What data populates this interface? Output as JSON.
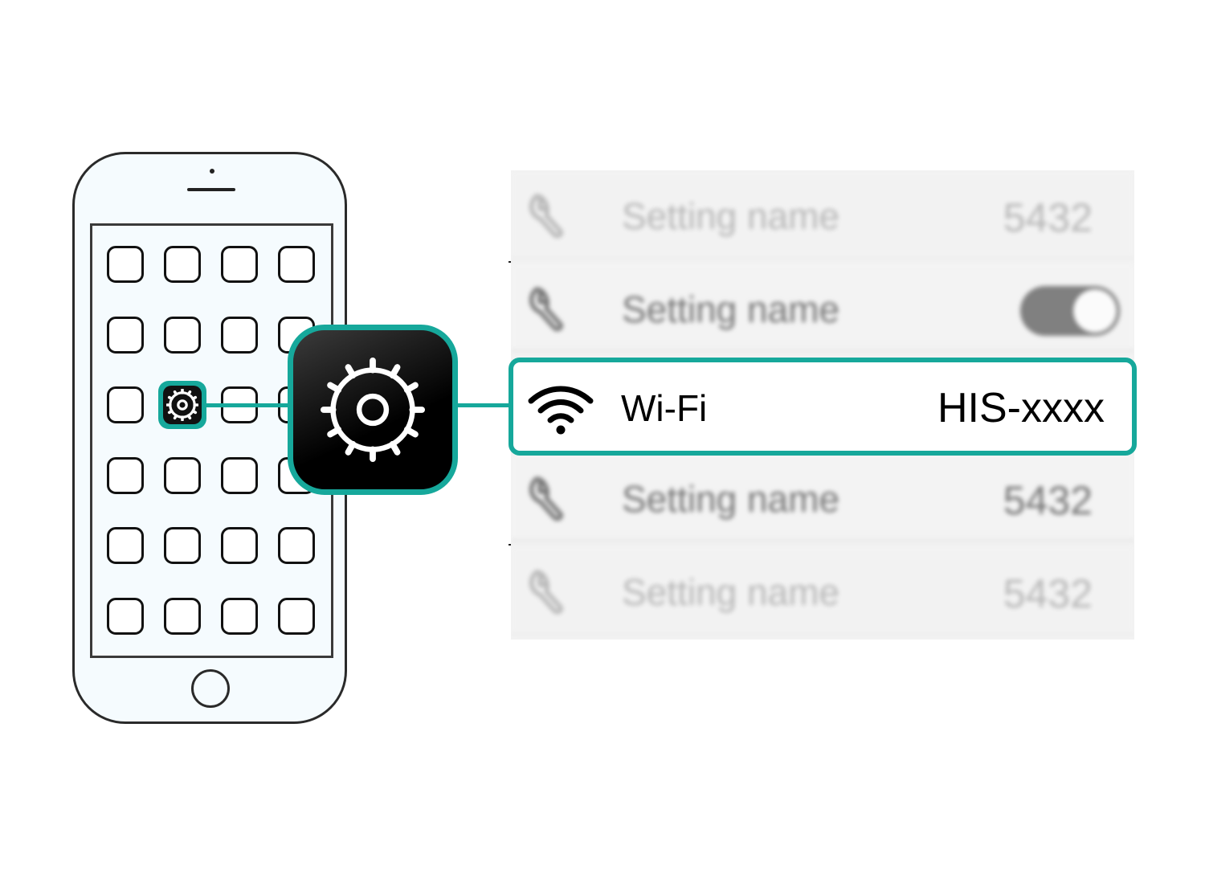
{
  "colors": {
    "accent": "#16a89b",
    "phone_outline": "#2a2a2a",
    "phone_fill": "#f5fbfe",
    "app_icon_fill": "#111111"
  },
  "phone": {
    "app_grid": {
      "rows": 6,
      "cols": 4
    },
    "highlighted_app": {
      "row": 3,
      "col": 2,
      "icon": "gear-icon"
    }
  },
  "settings_app": {
    "icon": "gear-icon"
  },
  "settings_list": {
    "rows": [
      {
        "icon": "wrench-icon",
        "label": "Setting name",
        "value": "5432",
        "style": "faint-blur"
      },
      {
        "icon": "wrench-icon",
        "label": "Setting name",
        "value": "",
        "control": "toggle-on",
        "style": "blur"
      },
      {
        "icon": "wifi-icon",
        "label": "Wi-Fi",
        "value": "HIS-xxxx",
        "style": "highlighted"
      },
      {
        "icon": "wrench-icon",
        "label": "Setting name",
        "value": "5432",
        "style": "blur"
      },
      {
        "icon": "wrench-icon",
        "label": "Setting name",
        "value": "5432",
        "style": "faint-blur"
      }
    ]
  }
}
